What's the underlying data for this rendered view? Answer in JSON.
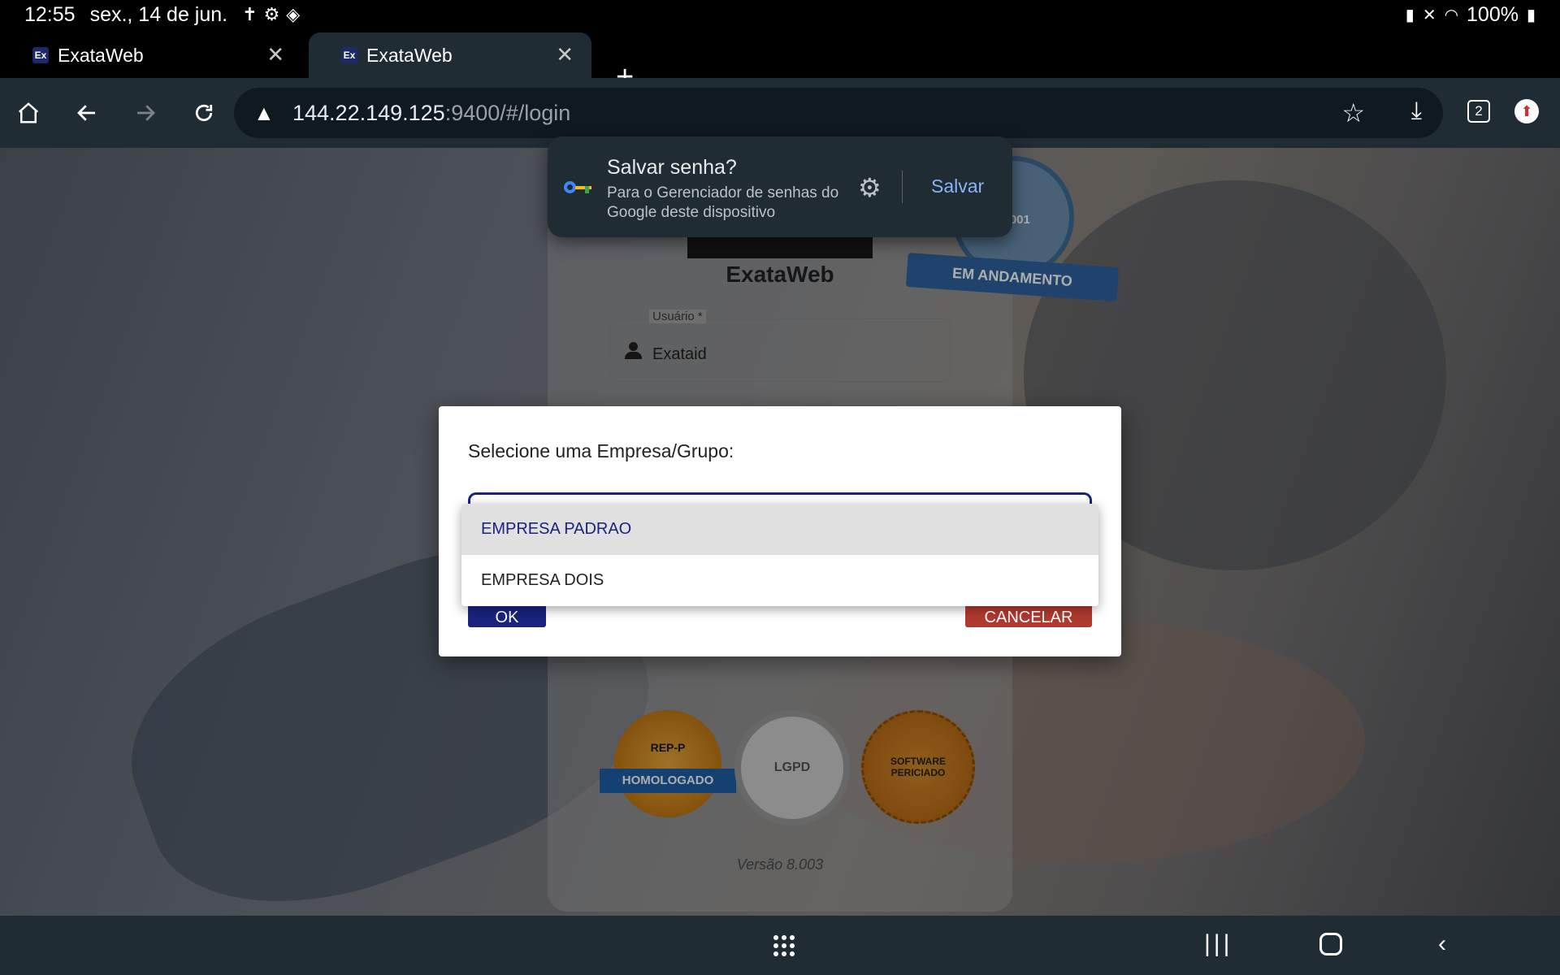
{
  "status_bar": {
    "time": "12:55",
    "date": "sex., 14 de jun.",
    "battery": "100%"
  },
  "tabs": [
    {
      "favicon": "Ex",
      "label": "ExataWeb"
    },
    {
      "favicon": "Ex",
      "label": "ExataWeb"
    }
  ],
  "toolbar": {
    "url_host": "144.22.149.125",
    "url_rest": ":9400/#/login",
    "tab_count": "2"
  },
  "save_password": {
    "title": "Salvar senha?",
    "subtitle": "Para o Gerenciador de senhas do Google deste dispositivo",
    "save_label": "Salvar"
  },
  "login": {
    "app_name": "ExataWeb",
    "user_label": "Usuário *",
    "user_value": "Exataid",
    "version": "Versão 8.003",
    "iso_number": "27001",
    "iso_ribbon": "EM ANDAMENTO",
    "badge_rep_title": "REP-P",
    "badge_rep_ribbon": "HOMOLOGADO",
    "badge_lgpd": "LGPD",
    "badge_software": "SOFTWARE PERICIADO"
  },
  "dialog": {
    "title": "Selecione uma Empresa/Grupo:",
    "ok_label": "OK",
    "cancel_label": "CANCELAR",
    "options": [
      "EMPRESA PADRAO",
      "EMPRESA DOIS"
    ],
    "selected_option": "EMPRESA PADRAO"
  },
  "colors": {
    "primary": "#1a237e",
    "cancel": "#b03a30",
    "browser_chrome": "#1f2c34",
    "link_blue": "#8ab4f8"
  }
}
